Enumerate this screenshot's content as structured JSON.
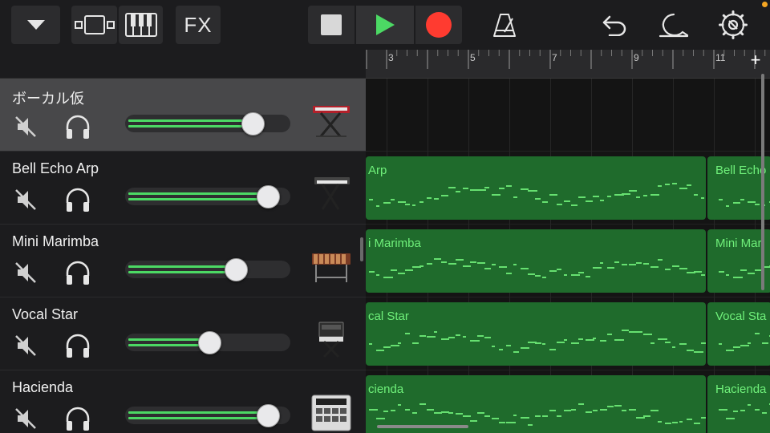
{
  "toolbar": {
    "fx_label": "FX",
    "icons": [
      "dropdown-icon",
      "tracks-view-icon",
      "keyboard-icon",
      "stop-icon",
      "play-icon",
      "record-icon",
      "metronome-icon",
      "undo-icon",
      "loop-icon",
      "settings-icon"
    ]
  },
  "ruler": {
    "bars": [
      "3",
      "5",
      "7",
      "9",
      "11"
    ],
    "add_label": "+"
  },
  "tracks": [
    {
      "name": "ボーカル仮",
      "instrument_icon": "keyboard-stand-icon",
      "volume": 0.83,
      "selected": true,
      "region": ""
    },
    {
      "name": "Bell Echo Arp",
      "instrument_icon": "synth-stand-icon",
      "volume": 0.93,
      "selected": false,
      "region": "Arp",
      "region2": "Bell Echo"
    },
    {
      "name": "Mini Marimba",
      "instrument_icon": "marimba-icon",
      "volume": 0.72,
      "selected": false,
      "region": "i Marimba",
      "region2": "Mini Mar"
    },
    {
      "name": "Vocal Star",
      "instrument_icon": "vocal-synth-icon",
      "volume": 0.54,
      "selected": false,
      "region": "cal Star",
      "region2": "Vocal Sta"
    },
    {
      "name": "Hacienda",
      "instrument_icon": "drum-machine-icon",
      "volume": 0.93,
      "selected": false,
      "region": "cienda",
      "region2": "Hacienda"
    }
  ],
  "colors": {
    "accent_green": "#4cd964",
    "record_red": "#ff3b30",
    "region_green": "#1f6b2c",
    "region_text": "#6ff07a",
    "selected_track": "#48484a"
  }
}
